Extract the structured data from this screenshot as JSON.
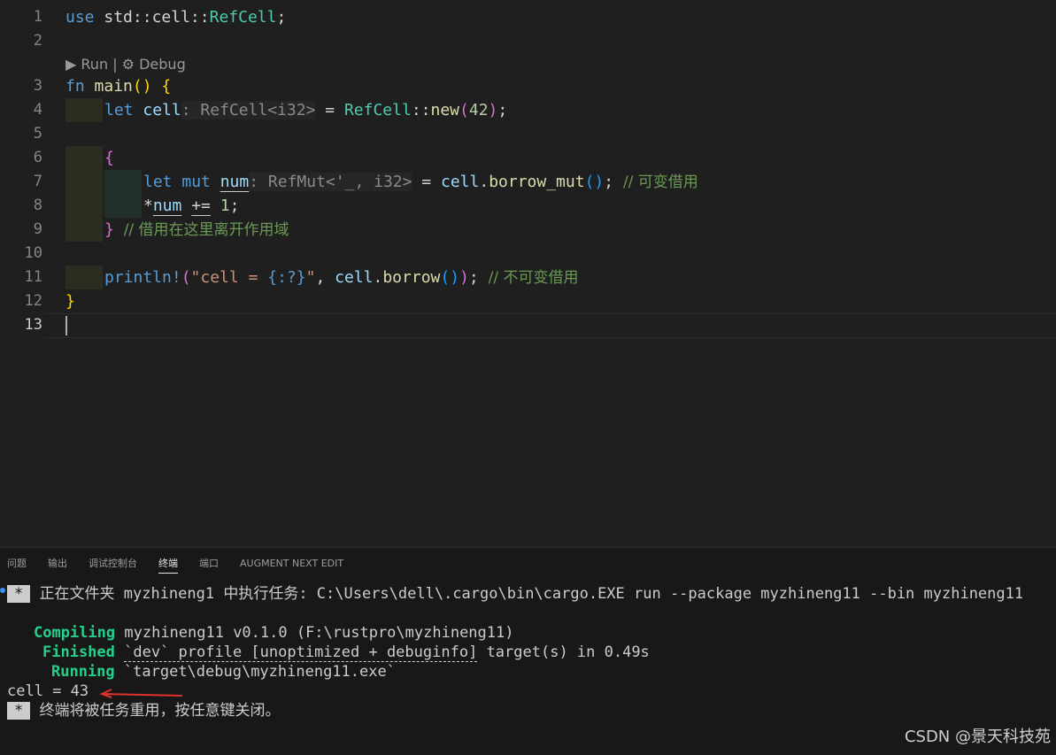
{
  "editor": {
    "line_numbers": [
      "1",
      "2",
      "3",
      "4",
      "5",
      "6",
      "7",
      "8",
      "9",
      "10",
      "11",
      "12",
      "13"
    ],
    "codelens": {
      "run": "Run",
      "separator": "|",
      "debug": "Debug"
    },
    "code": {
      "l1": {
        "kw": "use",
        "path1": "std",
        "sep1": "::",
        "path2": "cell",
        "sep2": "::",
        "ty": "RefCell",
        "end": ";"
      },
      "l3": {
        "kw": "fn",
        "name": "main",
        "parens": "()",
        "brace": "{"
      },
      "l4": {
        "kw": "let",
        "var": "cell",
        "hint": ": RefCell<i32>",
        "eq": " = ",
        "ty": "RefCell",
        "sep": "::",
        "fn": "new",
        "open": "(",
        "num": "42",
        "close": ")",
        "end": ";"
      },
      "l6": {
        "brace": "{"
      },
      "l7": {
        "kw1": "let",
        "kw2": "mut",
        "var": "num",
        "hint": ": RefMut<'_, i32>",
        "eq": " = ",
        "obj": "cell",
        "dot": ".",
        "fn": "borrow_mut",
        "parens": "()",
        "end": ";",
        "comment": "// 可变借用"
      },
      "l8": {
        "deref": "*",
        "var": "num",
        "op": "+=",
        "num": "1",
        "end": ";"
      },
      "l9": {
        "brace": "}",
        "comment": "// 借用在这里离开作用域"
      },
      "l11": {
        "macro": "println!",
        "open": "(",
        "str1": "\"cell = ",
        "fmt": "{:?}",
        "str2": "\"",
        "comma": ", ",
        "obj": "cell",
        "dot": ".",
        "fn": "borrow",
        "parens": "()",
        "close": ")",
        "end": ";",
        "comment": "// 不可变借用"
      },
      "l12": {
        "brace": "}"
      }
    }
  },
  "panel": {
    "tabs": [
      "问题",
      "输出",
      "调试控制台",
      "终端",
      "端口",
      "AUGMENT NEXT EDIT"
    ],
    "active_tab": "终端",
    "terminal": {
      "task_star": "*",
      "task_line": "正在文件夹 myzhineng1 中执行任务: C:\\Users\\dell\\.cargo\\bin\\cargo.EXE run --package myzhineng11 --bin myzhineng11",
      "compiling_label": "Compiling",
      "compiling_text": "myzhineng11 v0.1.0 (F:\\rustpro\\myzhineng11)",
      "finished_label": "Finished",
      "finished_dashed": "`dev` profile [unoptimized + debuginfo]",
      "finished_rest": "target(s) in 0.49s",
      "running_label": "Running",
      "running_text": "`target\\debug\\myzhineng11.exe`",
      "output": "cell = 43",
      "reuse_star": "*",
      "reuse_text": "终端将被任务重用，按任意键关闭。"
    }
  },
  "watermark": "CSDN @景天科技苑",
  "colors": {
    "background": "#1f1f1f",
    "panel": "#181818",
    "green": "#23d18b",
    "arrow": "#e0312a"
  }
}
